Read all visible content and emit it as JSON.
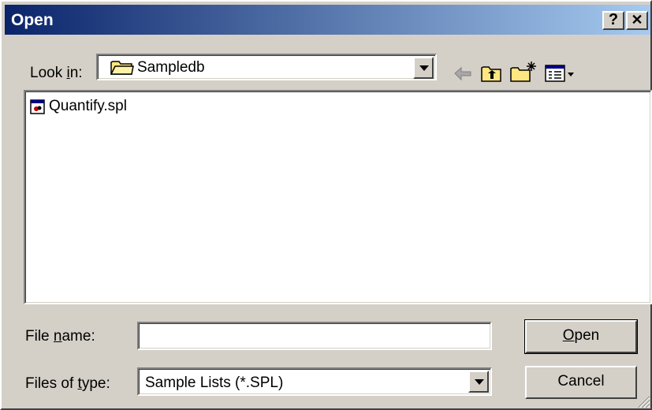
{
  "window": {
    "title": "Open",
    "help_label": "?",
    "close_label": "✕"
  },
  "lookin": {
    "label_pre": "Look ",
    "label_u": "i",
    "label_post": "n:",
    "value": "Sampledb",
    "icon": "folder-icon"
  },
  "toolbar": {
    "back_icon": "back-arrow-icon",
    "up_icon": "up-folder-icon",
    "new_folder_icon": "new-folder-icon",
    "view_icon": "view-menu-icon"
  },
  "files": [
    {
      "name": "Quantify.spl",
      "icon": "spl-file-icon"
    }
  ],
  "filename": {
    "label_pre": "File ",
    "label_u": "n",
    "label_post": "ame:",
    "value": ""
  },
  "filetype": {
    "label_pre": "Files of ",
    "label_u": "t",
    "label_post": "ype:",
    "value": "Sample Lists (*.SPL)"
  },
  "buttons": {
    "open_u": "O",
    "open_rest": "pen",
    "cancel": "Cancel"
  }
}
